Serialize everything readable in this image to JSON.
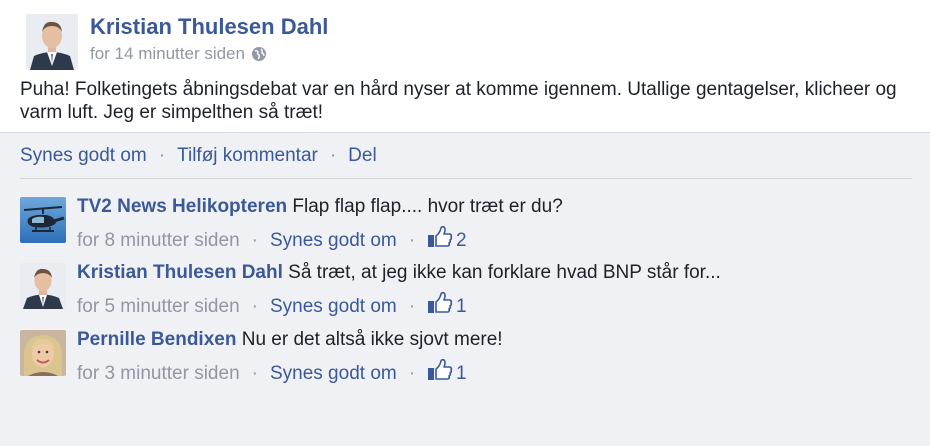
{
  "post": {
    "author": "Kristian Thulesen Dahl",
    "timestamp": "for 14 minutter siden",
    "privacy_icon": "globe-icon",
    "text": "Puha! Folketingets åbningsdebat var en hård nyser at komme igennem. Utallige gentagelser, klicheer og varm luft. Jeg er simpelthen så træt!"
  },
  "actions": {
    "like_label": "Synes godt om",
    "comment_label": "Tilføj kommentar",
    "share_label": "Del",
    "separator": "·"
  },
  "comments": [
    {
      "author": "TV2 News Helikopteren",
      "text": "Flap flap flap.... hvor træt er du?",
      "timestamp": "for 8 minutter siden",
      "like_label": "Synes godt om",
      "likes": "2",
      "avatar_icon": "helicopter-avatar"
    },
    {
      "author": "Kristian Thulesen Dahl",
      "text": "Så træt, at jeg ikke kan forklare hvad BNP står for...",
      "timestamp": "for 5 minutter siden",
      "like_label": "Synes godt om",
      "likes": "1",
      "avatar_icon": "man-in-suit-avatar"
    },
    {
      "author": "Pernille Bendixen",
      "text": "Nu er det altså ikke sjovt mere!",
      "timestamp": "for 3 minutter siden",
      "like_label": "Synes godt om",
      "likes": "1",
      "avatar_icon": "blonde-woman-avatar"
    }
  ],
  "colors": {
    "link": "#3b5998",
    "meta": "#9197a3",
    "text": "#1d2129",
    "background": "#f0f1f4"
  }
}
